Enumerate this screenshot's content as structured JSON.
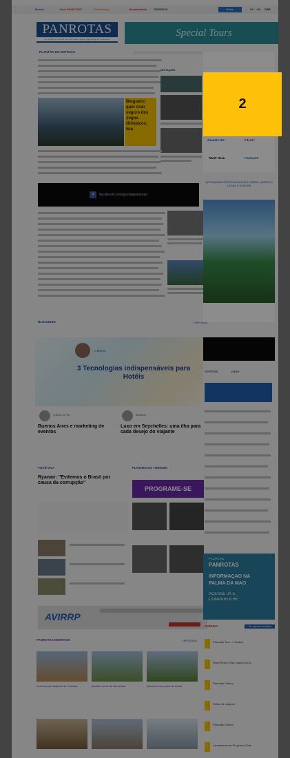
{
  "nav": {
    "items": [
      "Mundo",
      "Guia PANROTAS",
      "EsferaCorp",
      "Hospitalidade",
      "EVENTOS"
    ],
    "login": "Entrar",
    "languages": [
      "ES",
      "EN"
    ],
    "brand_small": "CWT"
  },
  "header": {
    "logo": "PANROTAS",
    "tagline": "O melhor portal de notícias para agentes de viagem",
    "special": "Special Tours"
  },
  "badge": "2",
  "sections": {
    "planta": "PLANTÃO DE NOTÍCIAS",
    "destaques": "DESTAQUES",
    "bloggers": "BLOGGERS",
    "voceviu": "VOCÊ VIU?",
    "flashes": "FLASHES DO TURISMO",
    "destinos": "PANROTAS DESTINOS",
    "agenda": "AGENDA",
    "noticias": "NOTÍCIAS",
    "lidas": "LIDAS",
    "ver_mais": "+ VER MAIS",
    "revistas": "+ REVISTAS"
  },
  "feature": {
    "headline": "Blogueiro quer criar seguro dos Jogos Olímpicos; leia",
    "caption": "Blogueiro quer criar seguro dos Jogos Olímpicos"
  },
  "facebook": {
    "text": "facebook.com/portalpanrotas",
    "icon": "f"
  },
  "banner": {
    "title": "3 Tecnologias indispensáveis para Hotéis",
    "byline": "Chris A."
  },
  "blog_posts": [
    {
      "title": "Buenos Aires e marketing de eventos",
      "author": "Fulano de Tal"
    },
    {
      "title": "Luxo em Seychelles: uma ilha para cada desejo do viajante",
      "author": "Beltrano"
    }
  ],
  "voceviu_headline": "Ryanair: \"Evitemos o Brasil por causa da corrupção\"",
  "cta": "PROGRAME-SE",
  "avirrp": "AVIRRP",
  "right": {
    "partners": [
      "AGENTUR",
      "FLOT",
      "NEW AGE",
      "POLLUX"
    ],
    "promo_heading": "OPERADORA ESPECIALISTA EM CARIBE, AMÉRICA LATINA E EUROPA",
    "app_promo": [
      "PORTAL",
      "PANROTAS",
      "INFORMAÇÃO NA",
      "PALMA DA MÃO",
      "ACESSE JÁ E",
      "COMPARTILHE"
    ],
    "agenda_button": "Ver agenda completa"
  },
  "agenda": [
    "Panrotas Tour — Cuiabá",
    "Road Show Chile Capital 24/16",
    "Panrotas Chines",
    "Feirão de viagens",
    "Panrotas Chines",
    "Lançamento do Programa Guia"
  ],
  "destinos": [
    "Conheça as atrações de Coimbra",
    "Destino verde de Barcelona",
    "Descubra as praias do Brasil"
  ]
}
